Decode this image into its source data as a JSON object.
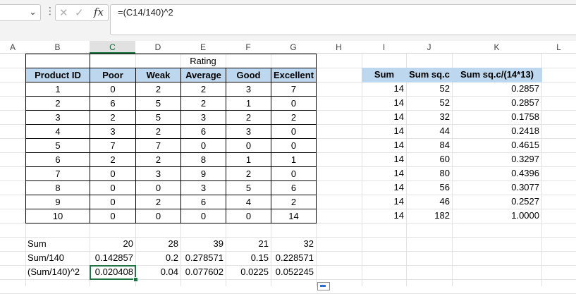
{
  "formula_bar": {
    "formula": "=(C14/140)^2",
    "fx_label": "fx"
  },
  "columns": [
    "A",
    "B",
    "C",
    "D",
    "E",
    "F",
    "G",
    "H",
    "I",
    "J",
    "K",
    "L"
  ],
  "table": {
    "group_header": "Rating",
    "headers": [
      "Product ID",
      "Poor",
      "Weak",
      "Average",
      "Good",
      "Excellent"
    ],
    "rows": [
      [
        "1",
        "0",
        "2",
        "2",
        "3",
        "7"
      ],
      [
        "2",
        "6",
        "5",
        "2",
        "1",
        "0"
      ],
      [
        "3",
        "2",
        "5",
        "3",
        "2",
        "2"
      ],
      [
        "4",
        "3",
        "2",
        "6",
        "3",
        "0"
      ],
      [
        "5",
        "7",
        "7",
        "0",
        "0",
        "0"
      ],
      [
        "6",
        "2",
        "2",
        "8",
        "1",
        "1"
      ],
      [
        "7",
        "0",
        "3",
        "9",
        "2",
        "0"
      ],
      [
        "8",
        "0",
        "0",
        "3",
        "5",
        "6"
      ],
      [
        "9",
        "0",
        "2",
        "6",
        "4",
        "2"
      ],
      [
        "10",
        "0",
        "0",
        "0",
        "0",
        "14"
      ]
    ]
  },
  "summary": {
    "rows": [
      {
        "label": "Sum",
        "values": [
          "20",
          "28",
          "39",
          "21",
          "32"
        ]
      },
      {
        "label": "Sum/140",
        "values": [
          "0.142857",
          "0.2",
          "0.278571",
          "0.15",
          "0.228571"
        ]
      },
      {
        "label": "(Sum/140)^2",
        "values": [
          "0.020408",
          "0.04",
          "0.077602",
          "0.0225",
          "0.052245"
        ]
      }
    ]
  },
  "stats": {
    "headers": [
      "Sum",
      "Sum sq.c",
      "Sum sq.c/(14*13)"
    ],
    "rows": [
      [
        "14",
        "52",
        "0.2857"
      ],
      [
        "14",
        "52",
        "0.2857"
      ],
      [
        "14",
        "32",
        "0.1758"
      ],
      [
        "14",
        "44",
        "0.2418"
      ],
      [
        "14",
        "84",
        "0.4615"
      ],
      [
        "14",
        "60",
        "0.3297"
      ],
      [
        "14",
        "80",
        "0.4396"
      ],
      [
        "14",
        "56",
        "0.3077"
      ],
      [
        "14",
        "46",
        "0.2527"
      ],
      [
        "14",
        "182",
        "1.0000"
      ]
    ]
  },
  "selected_cell": "C16"
}
